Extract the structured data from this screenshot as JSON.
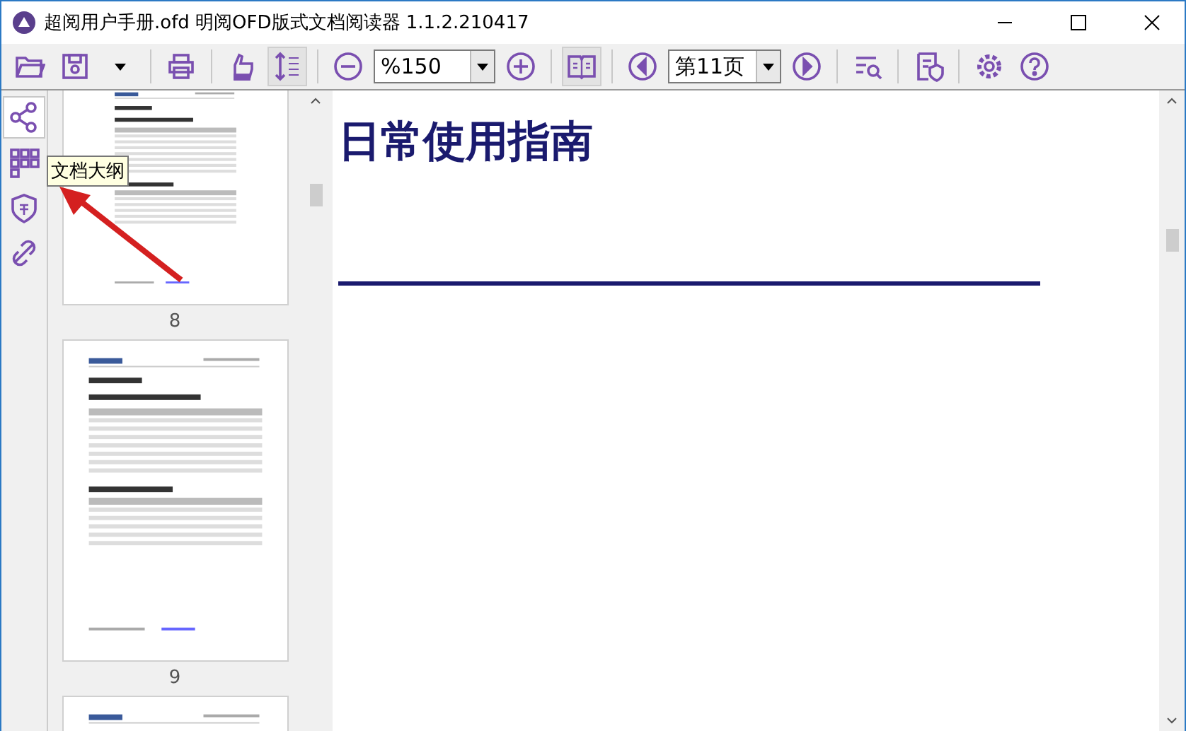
{
  "window": {
    "title": "超阅用户手册.ofd 明阅OFD版式文档阅读器 1.1.2.210417"
  },
  "toolbar": {
    "line_spacing_toggle": {
      "on": true
    },
    "book_view_toggle": {
      "on": true
    },
    "zoom_field": {
      "value": "%150"
    },
    "page_field": {
      "value": "第11页"
    }
  },
  "sidebar": {
    "tabs": [
      {
        "selected": true
      },
      {
        "selected": false
      },
      {
        "selected": false
      },
      {
        "selected": false
      }
    ],
    "tooltip": "文档大纲"
  },
  "thumbnails": [
    {
      "label": "8"
    },
    {
      "label": "9"
    }
  ],
  "document": {
    "heading": "日常使用指南"
  }
}
